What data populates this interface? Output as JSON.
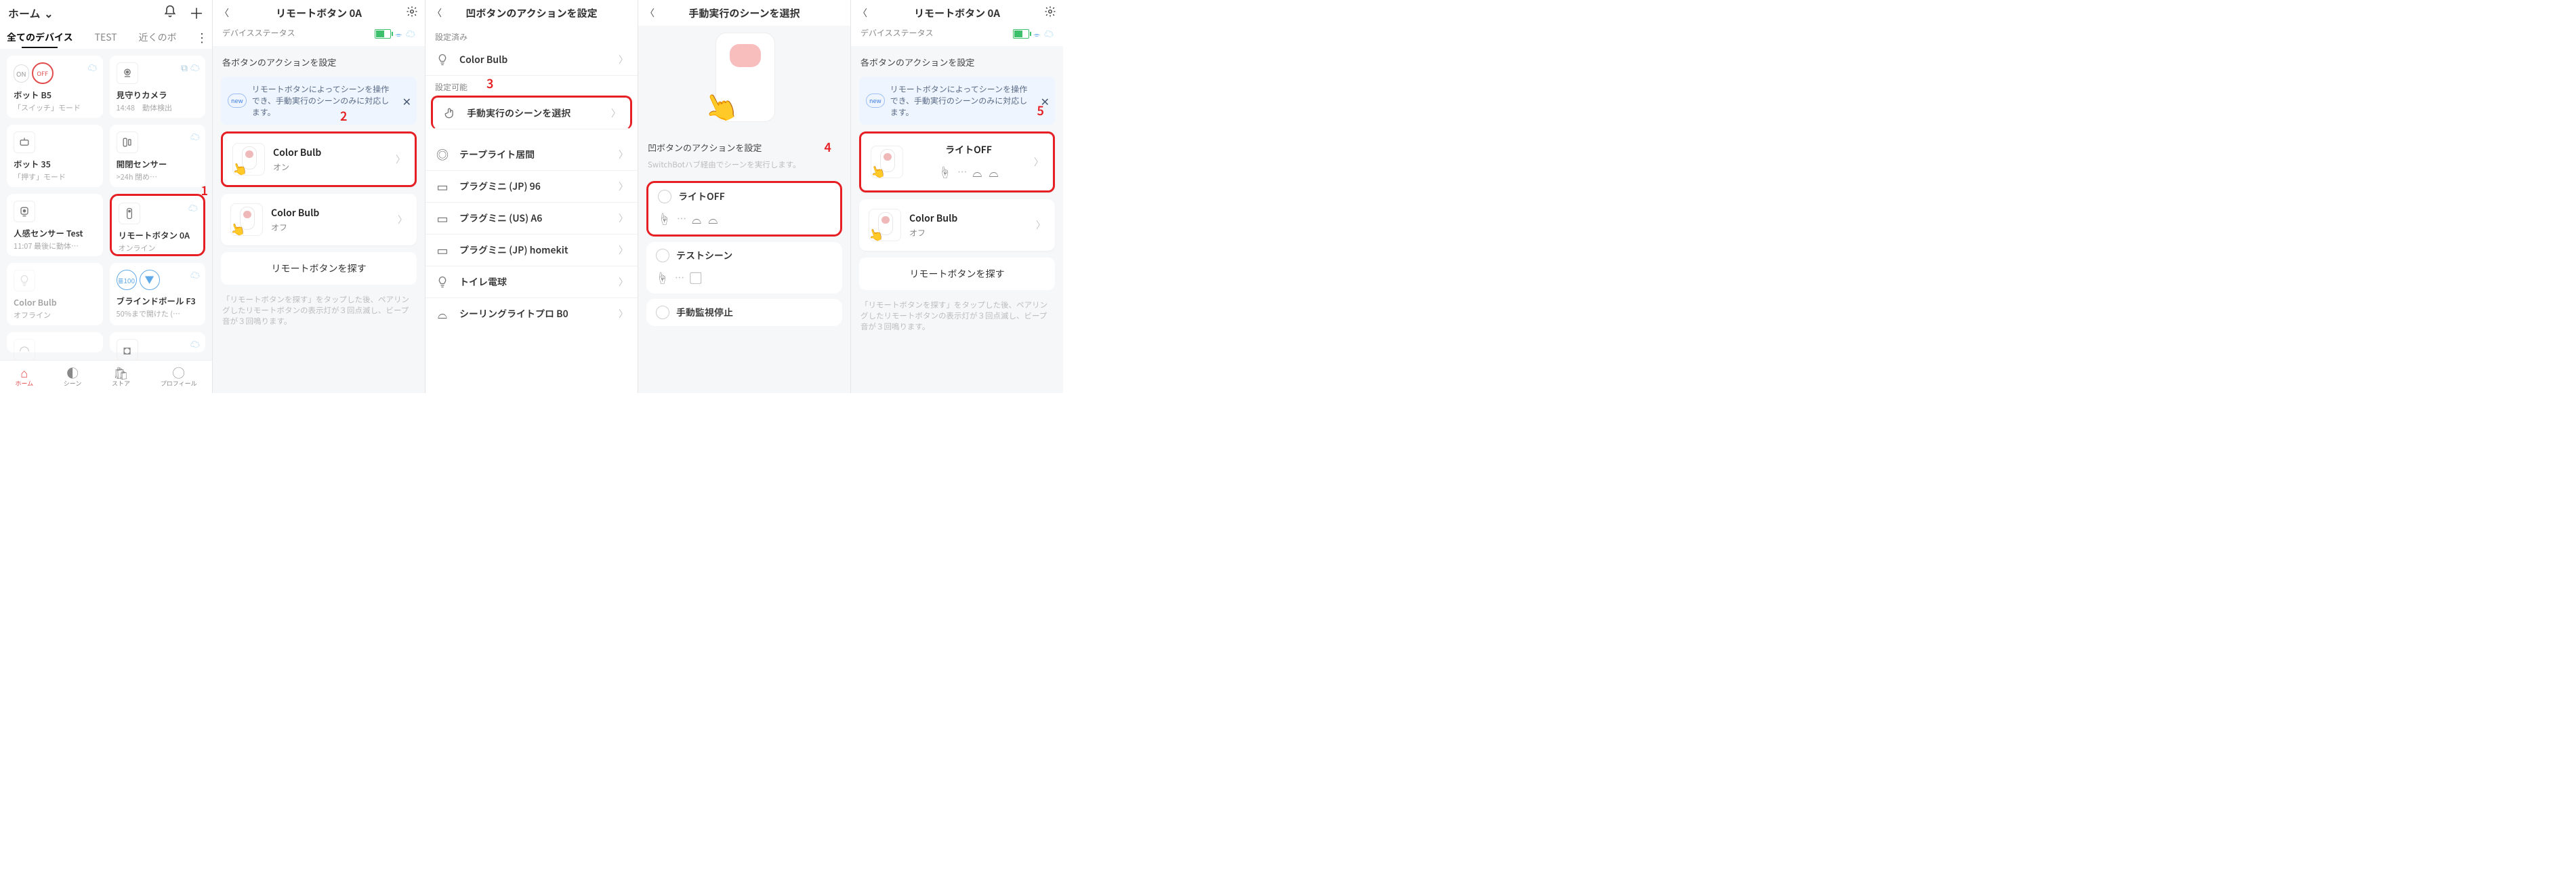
{
  "panel1": {
    "home_label": "ホーム",
    "tabs": {
      "all": "全てのデバイス",
      "test": "TEST",
      "near": "近くのボ"
    },
    "tiles": {
      "bot_b5": {
        "name": "ボット B5",
        "sub": "「スイッチ」モード",
        "on": "ON",
        "off": "OFF"
      },
      "camera": {
        "name": "見守りカメラ",
        "sub": "14:48　動体検出"
      },
      "bot_35": {
        "name": "ボット 35",
        "sub": "「押す」モード"
      },
      "contact": {
        "name": "開閉センサー",
        "sub": ">24h   閉め…"
      },
      "motion": {
        "name": "人感センサー Test",
        "sub": "11:07   最後に動体…"
      },
      "remote": {
        "name": "リモートボタン 0A",
        "sub": "オンライン"
      },
      "bulb": {
        "name": "Color Bulb",
        "sub": "オフライン"
      },
      "blind": {
        "name": "ブラインドポール  F3",
        "sub": "50%まで開けた (…",
        "pct": "100"
      },
      "step_num": "1"
    },
    "nav": {
      "home": "ホーム",
      "scene": "シーン",
      "store": "ストア",
      "profile": "プロフィール"
    }
  },
  "panel2": {
    "title": "リモートボタン 0A",
    "status_label": "デバイスステータス",
    "section": "各ボタンのアクションを設定",
    "banner": "リモートボタンによってシーンを操作でき、手動実行のシーンのみに対応します。",
    "top_btn": {
      "name": "Color Bulb",
      "state": "オン"
    },
    "bottom_btn": {
      "name": "Color Bulb",
      "state": "オフ"
    },
    "find": "リモートボタンを探す",
    "find_note": "「リモートボタンを探す」をタップした後、ペアリングしたリモートボタンの表示灯が３回点滅し、ビープ音が３回鳴ります。",
    "step_num": "2"
  },
  "panel3": {
    "title": "凹ボタンのアクションを設定",
    "set_already": "設定済み",
    "set_possible": "設定可能",
    "rows": {
      "color_bulb": "Color Bulb",
      "select_scene": "手動実行のシーンを選択",
      "tape_light": "テープライト居間",
      "plug_jp96": "プラグミニ (JP) 96",
      "plug_usa6": "プラグミニ (US) A6",
      "plug_homekit": "プラグミニ (JP) homekit",
      "toilet_bulb": "トイレ電球",
      "ceiling": "シーリングライトプロ B0"
    },
    "step_num": "3"
  },
  "panel4": {
    "title": "手動実行のシーンを選択",
    "section": "凹ボタンのアクションを設定",
    "sub": "SwitchBotハブ経由でシーンを実行します。",
    "scenes": {
      "light_off": "ライトOFF",
      "test_scene": "テストシーン",
      "manual_watch_stop": "手動監視停止"
    },
    "step_num": "4"
  },
  "panel5": {
    "title": "リモートボタン 0A",
    "status_label": "デバイスステータス",
    "section": "各ボタンのアクションを設定",
    "banner": "リモートボタンによってシーンを操作でき、手動実行のシーンのみに対応します。",
    "top_btn": {
      "name": "ライトOFF"
    },
    "bottom_btn": {
      "name": "Color Bulb",
      "state": "オフ"
    },
    "find": "リモートボタンを探す",
    "find_note": "「リモートボタンを探す」をタップした後、ペアリングしたリモートボタンの表示灯が３回点滅し、ビープ音が３回鳴ります。",
    "step_num": "5"
  }
}
